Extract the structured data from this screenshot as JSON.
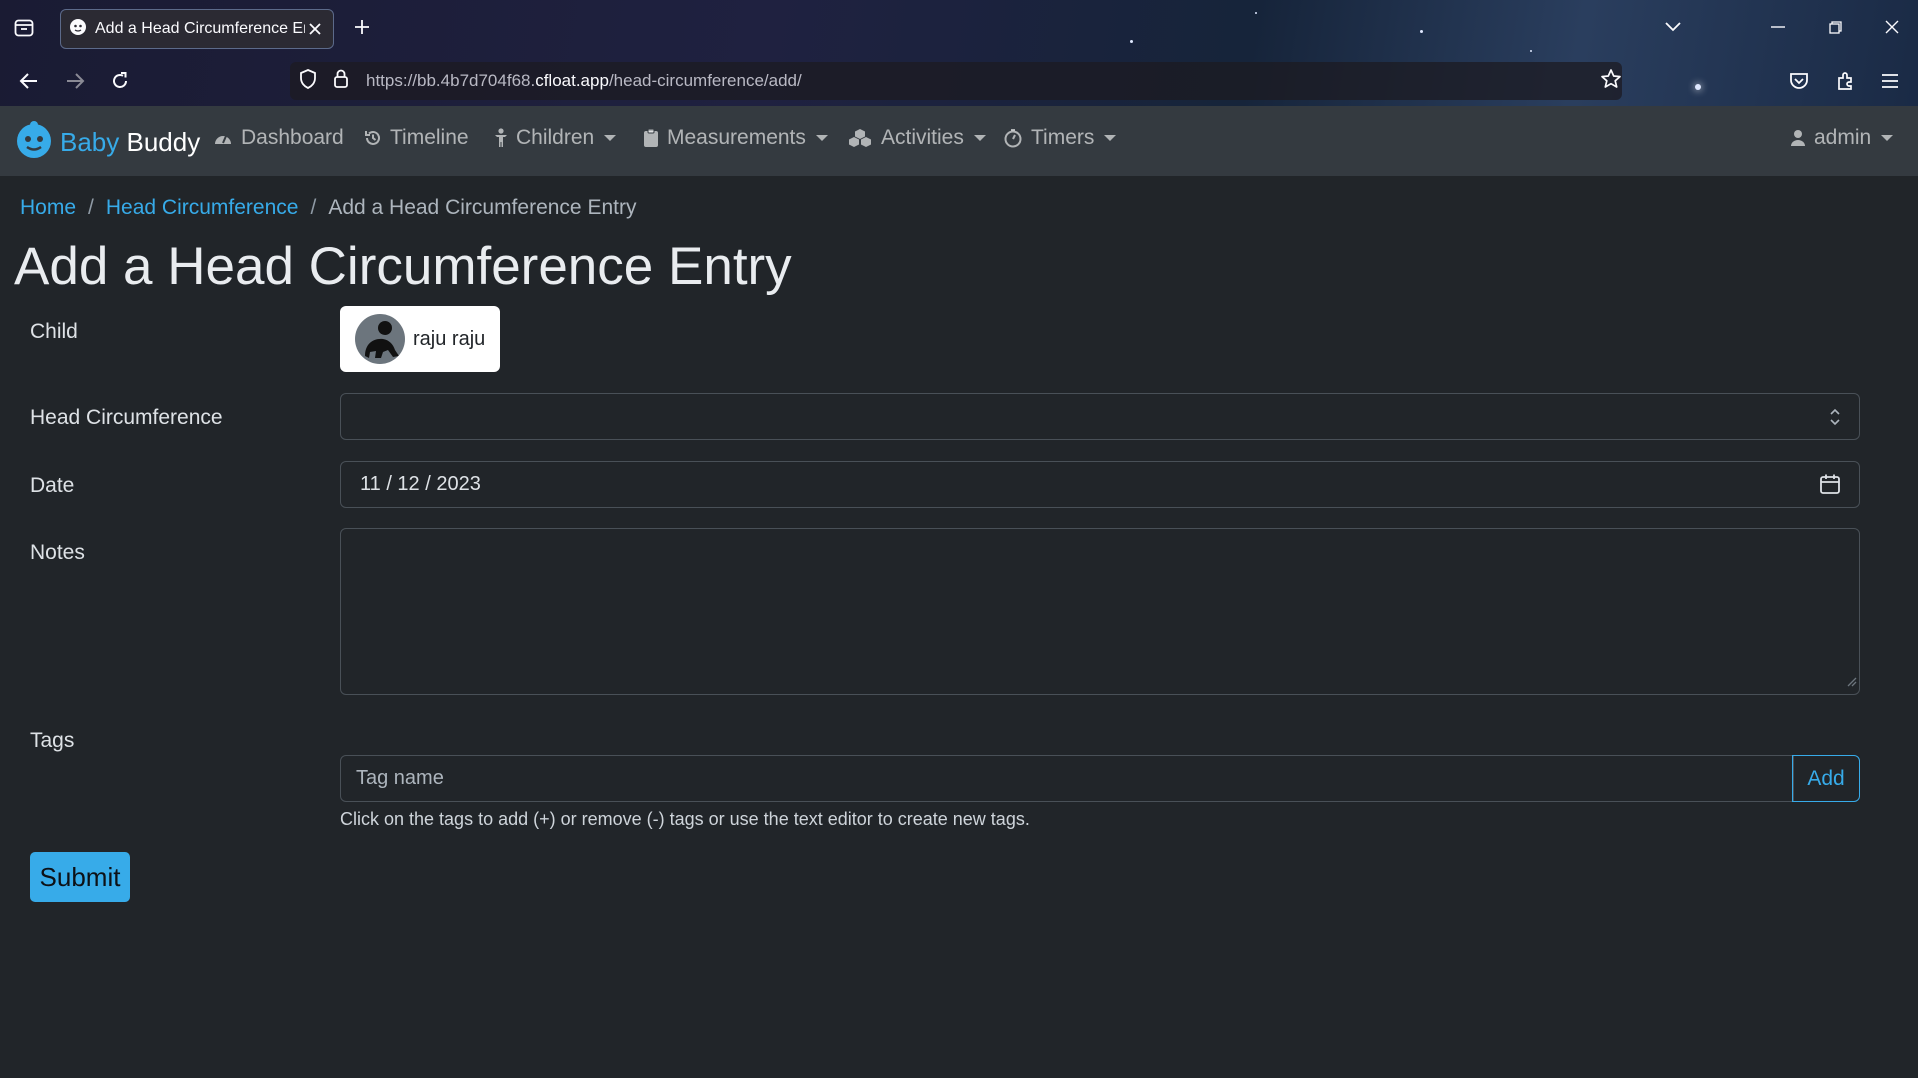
{
  "browser": {
    "tab_title": "Add a Head Circumference Entry",
    "url_prefix": "https://bb.4b7d704f68.",
    "url_host": "cfloat.app",
    "url_path": "/head-circumference/add/"
  },
  "nav": {
    "brand_baby": "Baby",
    "brand_buddy": "Buddy",
    "dashboard": "Dashboard",
    "timeline": "Timeline",
    "children": "Children",
    "measurements": "Measurements",
    "activities": "Activities",
    "timers": "Timers",
    "user": "admin"
  },
  "breadcrumb": {
    "home": "Home",
    "section": "Head Circumference",
    "current": "Add a Head Circumference Entry"
  },
  "page": {
    "title": "Add a Head Circumference Entry"
  },
  "form": {
    "child_label": "Child",
    "child_name": "raju raju",
    "head_label": "Head Circumference",
    "head_value": "",
    "date_label": "Date",
    "date_value": "11 / 12 / 2023",
    "notes_label": "Notes",
    "notes_value": "",
    "tags_label": "Tags",
    "tag_placeholder": "Tag name",
    "add_label": "Add",
    "tags_help": "Click on the tags to add (+) or remove (-) tags or use the text editor to create new tags.",
    "submit_label": "Submit"
  },
  "colors": {
    "background": "#212529",
    "navbar": "#343a40",
    "primary": "#37abe9"
  }
}
